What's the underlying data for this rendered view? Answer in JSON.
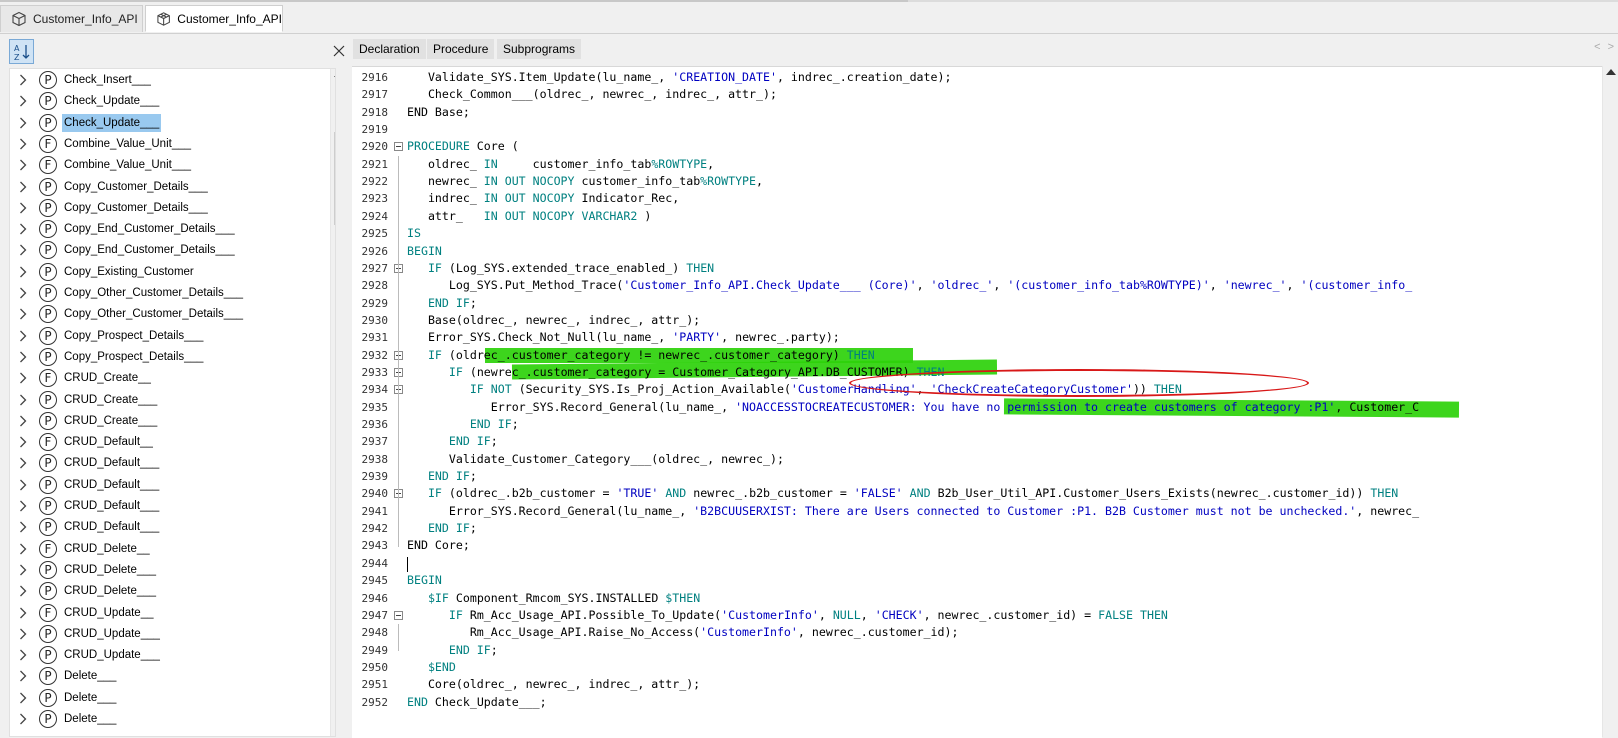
{
  "tabs": [
    {
      "label": "Customer_Info_API",
      "icon": "package-icon",
      "active": false
    },
    {
      "label": "Customer_Info_API",
      "icon": "package-body-icon",
      "active": true
    }
  ],
  "left_panel": {
    "sort_button_icon": "sort-az-icon",
    "close_icon": "close-icon",
    "items": [
      {
        "type": "P",
        "label": "Check_Insert___"
      },
      {
        "type": "P",
        "label": "Check_Update___"
      },
      {
        "type": "P",
        "label": "Check_Update___",
        "selected": true
      },
      {
        "type": "F",
        "label": "Combine_Value_Unit___"
      },
      {
        "type": "F",
        "label": "Combine_Value_Unit___"
      },
      {
        "type": "P",
        "label": "Copy_Customer_Details___"
      },
      {
        "type": "P",
        "label": "Copy_Customer_Details___"
      },
      {
        "type": "P",
        "label": "Copy_End_Customer_Details___"
      },
      {
        "type": "P",
        "label": "Copy_End_Customer_Details___"
      },
      {
        "type": "P",
        "label": "Copy_Existing_Customer"
      },
      {
        "type": "P",
        "label": "Copy_Other_Customer_Details___"
      },
      {
        "type": "P",
        "label": "Copy_Other_Customer_Details___"
      },
      {
        "type": "P",
        "label": "Copy_Prospect_Details___"
      },
      {
        "type": "P",
        "label": "Copy_Prospect_Details___"
      },
      {
        "type": "F",
        "label": "CRUD_Create__"
      },
      {
        "type": "P",
        "label": "CRUD_Create___"
      },
      {
        "type": "P",
        "label": "CRUD_Create___"
      },
      {
        "type": "F",
        "label": "CRUD_Default__"
      },
      {
        "type": "P",
        "label": "CRUD_Default___"
      },
      {
        "type": "P",
        "label": "CRUD_Default___"
      },
      {
        "type": "P",
        "label": "CRUD_Default___"
      },
      {
        "type": "P",
        "label": "CRUD_Default___"
      },
      {
        "type": "F",
        "label": "CRUD_Delete__"
      },
      {
        "type": "P",
        "label": "CRUD_Delete___"
      },
      {
        "type": "P",
        "label": "CRUD_Delete___"
      },
      {
        "type": "F",
        "label": "CRUD_Update__"
      },
      {
        "type": "P",
        "label": "CRUD_Update___"
      },
      {
        "type": "P",
        "label": "CRUD_Update___"
      },
      {
        "type": "P",
        "label": "Delete___"
      },
      {
        "type": "P",
        "label": "Delete___"
      },
      {
        "type": "P",
        "label": "Delete___"
      }
    ]
  },
  "editor": {
    "tabs": [
      "Declaration",
      "Procedure",
      "Subprograms"
    ],
    "nav_arrows": "< >",
    "lines": [
      {
        "n": "2916",
        "segs": [
          [
            "   Validate_SYS.Item_Update(lu_name_, ",
            ""
          ],
          [
            "'CREATION_DATE'",
            "str"
          ],
          [
            ", indrec_.creation_date);",
            ""
          ]
        ]
      },
      {
        "n": "2917",
        "segs": [
          [
            "   Check_Common___(oldrec_, newrec_, indrec_, attr_);",
            ""
          ]
        ]
      },
      {
        "n": "2918",
        "segs": [
          [
            "END Base;",
            ""
          ]
        ]
      },
      {
        "n": "2919",
        "segs": [
          [
            "",
            ""
          ]
        ]
      },
      {
        "n": "2920",
        "segs": [
          [
            "PROCEDURE",
            "kw"
          ],
          [
            " Core (",
            ""
          ]
        ]
      },
      {
        "n": "2921",
        "segs": [
          [
            "   oldrec_ ",
            ""
          ],
          [
            "IN",
            "kw"
          ],
          [
            "     customer_info_tab",
            ""
          ],
          [
            "%ROWTYPE",
            "kw"
          ],
          [
            ",",
            ""
          ]
        ]
      },
      {
        "n": "2922",
        "segs": [
          [
            "   newrec_ ",
            ""
          ],
          [
            "IN OUT NOCOPY",
            "kw"
          ],
          [
            " customer_info_tab",
            ""
          ],
          [
            "%ROWTYPE",
            "kw"
          ],
          [
            ",",
            ""
          ]
        ]
      },
      {
        "n": "2923",
        "segs": [
          [
            "   indrec_ ",
            ""
          ],
          [
            "IN OUT NOCOPY",
            "kw"
          ],
          [
            " Indicator_Rec,",
            ""
          ]
        ]
      },
      {
        "n": "2924",
        "segs": [
          [
            "   attr_   ",
            ""
          ],
          [
            "IN OUT NOCOPY VARCHAR2",
            "kw"
          ],
          [
            " )",
            ""
          ]
        ]
      },
      {
        "n": "2925",
        "segs": [
          [
            "IS",
            "kw"
          ]
        ]
      },
      {
        "n": "2926",
        "segs": [
          [
            "BEGIN",
            "kw"
          ]
        ]
      },
      {
        "n": "2927",
        "segs": [
          [
            "   ",
            ""
          ],
          [
            "IF",
            "kw"
          ],
          [
            " (Log_SYS.extended_trace_enabled_) ",
            ""
          ],
          [
            "THEN",
            "kw"
          ]
        ]
      },
      {
        "n": "2928",
        "segs": [
          [
            "      Log_SYS.Put_Method_Trace(",
            ""
          ],
          [
            "'Customer_Info_API.Check_Update___ (Core)'",
            "str"
          ],
          [
            ", ",
            ""
          ],
          [
            "'oldrec_'",
            "str"
          ],
          [
            ", ",
            ""
          ],
          [
            "'(customer_info_tab%ROWTYPE)'",
            "str"
          ],
          [
            ", ",
            ""
          ],
          [
            "'newrec_'",
            "str"
          ],
          [
            ", ",
            ""
          ],
          [
            "'(customer_info_",
            "str"
          ]
        ]
      },
      {
        "n": "2929",
        "segs": [
          [
            "   ",
            ""
          ],
          [
            "END IF",
            "kw"
          ],
          [
            ";",
            ""
          ]
        ]
      },
      {
        "n": "2930",
        "segs": [
          [
            "   Base(oldrec_, newrec_, indrec_, attr_);",
            ""
          ]
        ]
      },
      {
        "n": "2931",
        "segs": [
          [
            "   Error_SYS.Check_Not_Null(lu_name_, ",
            ""
          ],
          [
            "'PARTY'",
            "str"
          ],
          [
            ", newrec_.party);",
            ""
          ]
        ]
      },
      {
        "n": "2932",
        "segs": [
          [
            "   ",
            ""
          ],
          [
            "IF",
            "kw"
          ],
          [
            " (oldrec_.customer_category != newrec_.customer_category) ",
            ""
          ],
          [
            "THEN",
            "kw"
          ]
        ]
      },
      {
        "n": "2933",
        "segs": [
          [
            "      ",
            ""
          ],
          [
            "IF",
            "kw"
          ],
          [
            " (newrec_.customer_category = Customer_Category_API.DB_CUSTOMER) ",
            ""
          ],
          [
            "THEN",
            "kw"
          ]
        ]
      },
      {
        "n": "2934",
        "segs": [
          [
            "         ",
            ""
          ],
          [
            "IF NOT",
            "kw"
          ],
          [
            " (Security_SYS.Is_Proj_Action_Available(",
            ""
          ],
          [
            "'CustomerHandling'",
            "str"
          ],
          [
            ", ",
            ""
          ],
          [
            "'CheckCreateCategoryCustomer'",
            "str"
          ],
          [
            ")) ",
            ""
          ],
          [
            "THEN",
            "kw"
          ]
        ]
      },
      {
        "n": "2935",
        "segs": [
          [
            "            Error_SYS.Record_General(lu_name_, ",
            ""
          ],
          [
            "'NOACCESSTOCREATECUSTOMER: You have no permission to create customers of category :P1'",
            "str"
          ],
          [
            ", Customer_C",
            ""
          ]
        ]
      },
      {
        "n": "2936",
        "segs": [
          [
            "         ",
            ""
          ],
          [
            "END IF",
            "kw"
          ],
          [
            ";",
            ""
          ]
        ]
      },
      {
        "n": "2937",
        "segs": [
          [
            "      ",
            ""
          ],
          [
            "END IF",
            "kw"
          ],
          [
            ";",
            ""
          ]
        ]
      },
      {
        "n": "2938",
        "segs": [
          [
            "      Validate_Customer_Category___(oldrec_, newrec_);",
            ""
          ]
        ]
      },
      {
        "n": "2939",
        "segs": [
          [
            "   ",
            ""
          ],
          [
            "END IF",
            "kw"
          ],
          [
            ";",
            ""
          ]
        ]
      },
      {
        "n": "2940",
        "segs": [
          [
            "   ",
            ""
          ],
          [
            "IF",
            "kw"
          ],
          [
            " (oldrec_.b2b_customer = ",
            ""
          ],
          [
            "'TRUE'",
            "str"
          ],
          [
            " ",
            ""
          ],
          [
            "AND",
            "kw"
          ],
          [
            " newrec_.b2b_customer = ",
            ""
          ],
          [
            "'FALSE'",
            "str"
          ],
          [
            " ",
            ""
          ],
          [
            "AND",
            "kw"
          ],
          [
            " B2b_User_Util_API.Customer_Users_Exists(newrec_.customer_id)) ",
            ""
          ],
          [
            "THEN",
            "kw"
          ]
        ]
      },
      {
        "n": "2941",
        "segs": [
          [
            "      Error_SYS.Record_General(lu_name_, ",
            ""
          ],
          [
            "'B2BCUUSERXIST: There are Users connected to Customer :P1. B2B Customer must not be unchecked.'",
            "str"
          ],
          [
            ", newrec_",
            ""
          ]
        ]
      },
      {
        "n": "2942",
        "segs": [
          [
            "   ",
            ""
          ],
          [
            "END IF",
            "kw"
          ],
          [
            ";",
            ""
          ]
        ]
      },
      {
        "n": "2943",
        "segs": [
          [
            "END Core;",
            ""
          ]
        ]
      },
      {
        "n": "2944",
        "segs": [
          [
            "",
            ""
          ]
        ]
      },
      {
        "n": "2945",
        "segs": [
          [
            "BEGIN",
            "kw"
          ]
        ]
      },
      {
        "n": "2946",
        "segs": [
          [
            "   ",
            ""
          ],
          [
            "$IF",
            "kw"
          ],
          [
            " Component_Rmcom_SYS.INSTALLED ",
            ""
          ],
          [
            "$THEN",
            "kw"
          ]
        ]
      },
      {
        "n": "2947",
        "segs": [
          [
            "      ",
            ""
          ],
          [
            "IF",
            "kw"
          ],
          [
            " Rm_Acc_Usage_API.Possible_To_Update(",
            ""
          ],
          [
            "'CustomerInfo'",
            "str"
          ],
          [
            ", ",
            ""
          ],
          [
            "NULL",
            "kw"
          ],
          [
            ", ",
            ""
          ],
          [
            "'CHECK'",
            "str"
          ],
          [
            ", newrec_.customer_id) = ",
            ""
          ],
          [
            "FALSE THEN",
            "kw"
          ]
        ]
      },
      {
        "n": "2948",
        "segs": [
          [
            "         Rm_Acc_Usage_API.Raise_No_Access(",
            ""
          ],
          [
            "'CustomerInfo'",
            "str"
          ],
          [
            ", newrec_.customer_id);",
            ""
          ]
        ]
      },
      {
        "n": "2949",
        "segs": [
          [
            "      ",
            ""
          ],
          [
            "END IF",
            "kw"
          ],
          [
            ";",
            ""
          ]
        ]
      },
      {
        "n": "2950",
        "segs": [
          [
            "   ",
            ""
          ],
          [
            "$END",
            "kw"
          ]
        ]
      },
      {
        "n": "2951",
        "segs": [
          [
            "   Core(oldrec_, newrec_, indrec_, attr_);",
            ""
          ]
        ]
      },
      {
        "n": "2952",
        "segs": [
          [
            "END",
            "kw"
          ],
          [
            " Check_Update___;",
            ""
          ]
        ]
      }
    ]
  },
  "colors": {
    "keyword": "#008080",
    "string": "#0000c0",
    "highlight": "#2dd10a",
    "annotation_circle": "#d81818",
    "selection": "#99c9ef"
  }
}
